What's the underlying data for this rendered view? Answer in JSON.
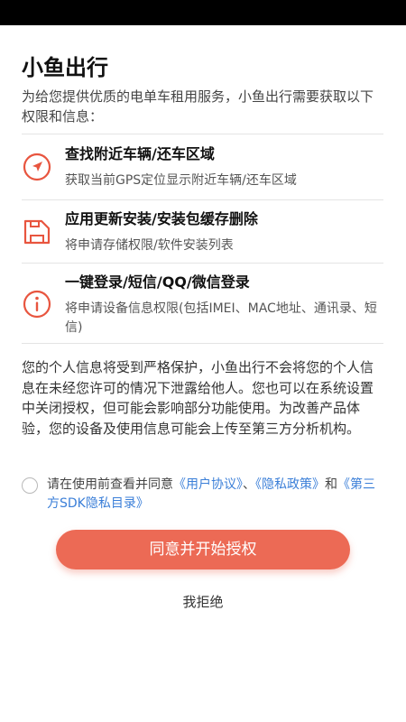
{
  "app": {
    "title": "小鱼出行",
    "intro": "为给您提供优质的电单车租用服务，小鱼出行需要获取以下权限和信息："
  },
  "permissions": [
    {
      "icon": "location-arrow-icon",
      "title": "查找附近车辆/还车区域",
      "desc": "获取当前GPS定位显示附近车辆/还车区域"
    },
    {
      "icon": "storage-card-icon",
      "title": "应用更新安装/安装包缓存删除",
      "desc": "将申请存储权限/软件安装列表"
    },
    {
      "icon": "info-icon",
      "title": "一键登录/短信/QQ/微信登录",
      "desc": "将申请设备信息权限(包括IMEI、MAC地址、通讯录、短信)"
    }
  ],
  "notice": "您的个人信息将受到严格保护，小鱼出行不会将您的个人信息在未经您许可的情况下泄露给他人。您也可以在系统设置中关闭授权，但可能会影响部分功能使用。为改善产品体验，您的设备及使用信息可能会上传至第三方分析机构。",
  "agreement": {
    "checked": false,
    "prefix": "请在使用前查看并同意",
    "user_agreement": "《用户协议》",
    "separator": "、",
    "privacy_policy": "《隐私政策》",
    "and": "和",
    "sdk_list": "《第三方SDK隐私目录》"
  },
  "buttons": {
    "agree": "同意并开始授权",
    "reject": "我拒绝"
  },
  "colors": {
    "accent": "#ec6a55",
    "link": "#3b7fd8",
    "icon": "#e8553f"
  }
}
